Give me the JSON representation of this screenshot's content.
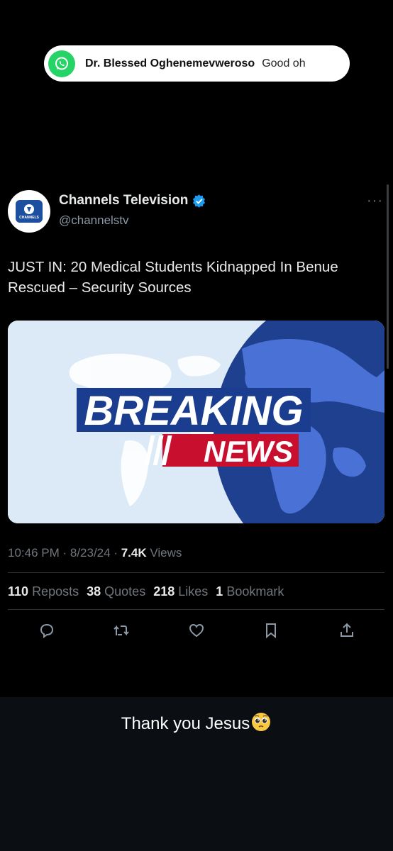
{
  "notification": {
    "app_icon": "whatsapp-icon",
    "sender": "Dr. Blessed Oghenemevweroso",
    "message": "Good oh"
  },
  "tweet": {
    "display_name": "Channels Television",
    "handle": "@channelstv",
    "verified_icon": "verified-badge-icon",
    "avatar_label": "CHANNELS",
    "text": "JUST IN: 20 Medical Students Kidnapped In Benue Rescued – Security Sources",
    "image": {
      "line1": "BREAKING",
      "line2": "NEWS",
      "colors": {
        "blue": "#1b3d8f",
        "red": "#c8102e",
        "globe": "#2b4ea8",
        "bg": "#dce9f6"
      }
    },
    "meta": {
      "time": "10:46 PM",
      "date": "8/23/24",
      "views_count": "7.4K",
      "views_label": "Views"
    },
    "stats": [
      {
        "count": "110",
        "label": "Reposts"
      },
      {
        "count": "38",
        "label": "Quotes"
      },
      {
        "count": "218",
        "label": "Likes"
      },
      {
        "count": "1",
        "label": "Bookmark"
      }
    ],
    "actions": [
      "reply-icon",
      "repost-icon",
      "like-icon",
      "bookmark-icon",
      "share-icon"
    ]
  },
  "caption": {
    "text": "Thank you Jesus",
    "emoji": "pleading-face-emoji"
  }
}
